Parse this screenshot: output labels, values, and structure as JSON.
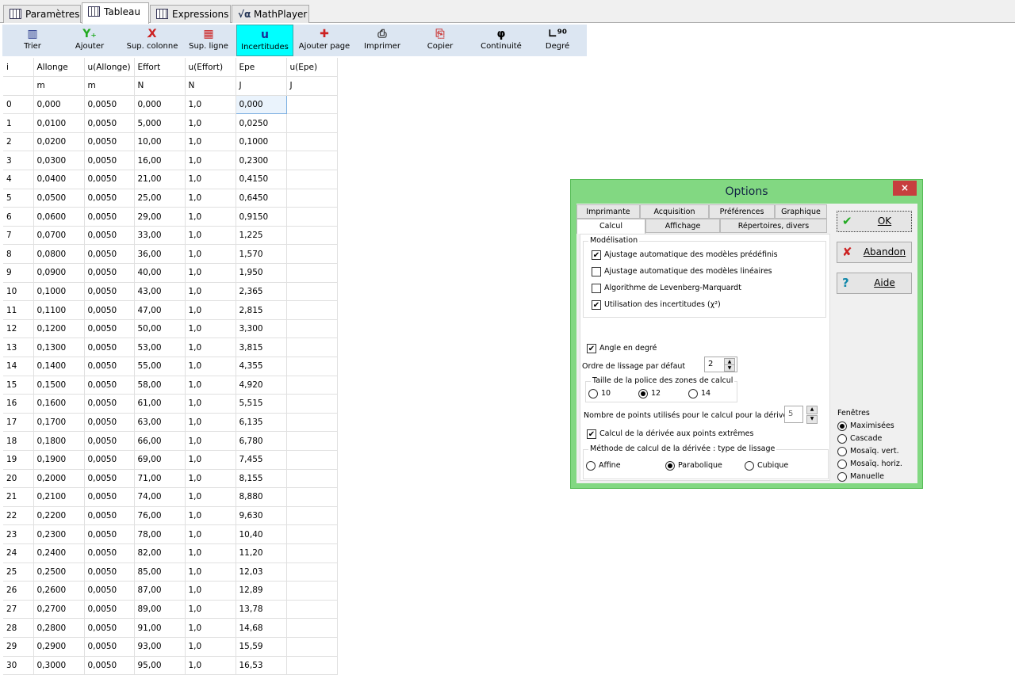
{
  "tabs": [
    {
      "label": "Paramètres",
      "icon": "table-icon"
    },
    {
      "label": "Tableau",
      "icon": "table-icon",
      "active": true
    },
    {
      "label": "Expressions",
      "icon": "expressions-icon"
    },
    {
      "label": "MathPlayer",
      "icon": "sqrt-alpha-icon"
    }
  ],
  "toolbar": [
    {
      "label": "Trier",
      "glyph": "▥",
      "color": "#223388"
    },
    {
      "label": "Ajouter",
      "glyph": "Y₊",
      "color": "#22aa22"
    },
    {
      "label": "Sup. colonne",
      "glyph": "X̸",
      "color": "#cc2222"
    },
    {
      "label": "Sup. ligne",
      "glyph": "▦",
      "color": "#cc2222"
    },
    {
      "label": "Incertitudes",
      "glyph": "u",
      "color": "#1a2a99",
      "active": true
    },
    {
      "label": "Ajouter page",
      "glyph": "✚",
      "color": "#cc2222"
    },
    {
      "label": "Imprimer",
      "glyph": "⎙",
      "color": "#333333"
    },
    {
      "label": "Copier",
      "glyph": "⎘",
      "color": "#cc4444"
    },
    {
      "label": "Continuité",
      "glyph": "φ",
      "color": "#000000"
    },
    {
      "label": "Degré",
      "glyph": "∟⁹⁰",
      "color": "#000000"
    }
  ],
  "table": {
    "headers": [
      "i",
      "Allonge",
      "u(Allonge)",
      "Effort",
      "u(Effort)",
      "Epe",
      "u(Epe)"
    ],
    "units": [
      "",
      "m",
      "m",
      "N",
      "N",
      "J",
      "J"
    ],
    "rows": [
      [
        "0",
        "0,000",
        "0,0050",
        "0,000",
        "1,0",
        "0,000",
        ""
      ],
      [
        "1",
        "0,0100",
        "0,0050",
        "5,000",
        "1,0",
        "0,0250",
        ""
      ],
      [
        "2",
        "0,0200",
        "0,0050",
        "10,00",
        "1,0",
        "0,1000",
        ""
      ],
      [
        "3",
        "0,0300",
        "0,0050",
        "16,00",
        "1,0",
        "0,2300",
        ""
      ],
      [
        "4",
        "0,0400",
        "0,0050",
        "21,00",
        "1,0",
        "0,4150",
        ""
      ],
      [
        "5",
        "0,0500",
        "0,0050",
        "25,00",
        "1,0",
        "0,6450",
        ""
      ],
      [
        "6",
        "0,0600",
        "0,0050",
        "29,00",
        "1,0",
        "0,9150",
        ""
      ],
      [
        "7",
        "0,0700",
        "0,0050",
        "33,00",
        "1,0",
        "1,225",
        ""
      ],
      [
        "8",
        "0,0800",
        "0,0050",
        "36,00",
        "1,0",
        "1,570",
        ""
      ],
      [
        "9",
        "0,0900",
        "0,0050",
        "40,00",
        "1,0",
        "1,950",
        ""
      ],
      [
        "10",
        "0,1000",
        "0,0050",
        "43,00",
        "1,0",
        "2,365",
        ""
      ],
      [
        "11",
        "0,1100",
        "0,0050",
        "47,00",
        "1,0",
        "2,815",
        ""
      ],
      [
        "12",
        "0,1200",
        "0,0050",
        "50,00",
        "1,0",
        "3,300",
        ""
      ],
      [
        "13",
        "0,1300",
        "0,0050",
        "53,00",
        "1,0",
        "3,815",
        ""
      ],
      [
        "14",
        "0,1400",
        "0,0050",
        "55,00",
        "1,0",
        "4,355",
        ""
      ],
      [
        "15",
        "0,1500",
        "0,0050",
        "58,00",
        "1,0",
        "4,920",
        ""
      ],
      [
        "16",
        "0,1600",
        "0,0050",
        "61,00",
        "1,0",
        "5,515",
        ""
      ],
      [
        "17",
        "0,1700",
        "0,0050",
        "63,00",
        "1,0",
        "6,135",
        ""
      ],
      [
        "18",
        "0,1800",
        "0,0050",
        "66,00",
        "1,0",
        "6,780",
        ""
      ],
      [
        "19",
        "0,1900",
        "0,0050",
        "69,00",
        "1,0",
        "7,455",
        ""
      ],
      [
        "20",
        "0,2000",
        "0,0050",
        "71,00",
        "1,0",
        "8,155",
        ""
      ],
      [
        "21",
        "0,2100",
        "0,0050",
        "74,00",
        "1,0",
        "8,880",
        ""
      ],
      [
        "22",
        "0,2200",
        "0,0050",
        "76,00",
        "1,0",
        "9,630",
        ""
      ],
      [
        "23",
        "0,2300",
        "0,0050",
        "78,00",
        "1,0",
        "10,40",
        ""
      ],
      [
        "24",
        "0,2400",
        "0,0050",
        "82,00",
        "1,0",
        "11,20",
        ""
      ],
      [
        "25",
        "0,2500",
        "0,0050",
        "85,00",
        "1,0",
        "12,03",
        ""
      ],
      [
        "26",
        "0,2600",
        "0,0050",
        "87,00",
        "1,0",
        "12,89",
        ""
      ],
      [
        "27",
        "0,2700",
        "0,0050",
        "89,00",
        "1,0",
        "13,78",
        ""
      ],
      [
        "28",
        "0,2800",
        "0,0050",
        "91,00",
        "1,0",
        "14,68",
        ""
      ],
      [
        "29",
        "0,2900",
        "0,0050",
        "93,00",
        "1,0",
        "15,59",
        ""
      ],
      [
        "30",
        "0,3000",
        "0,0050",
        "95,00",
        "1,0",
        "16,53",
        ""
      ]
    ]
  },
  "dialog": {
    "title": "Options",
    "tabs_row1": [
      "Imprimante",
      "Acquisition",
      "Préférences",
      "Graphique"
    ],
    "tabs_row2": [
      "Calcul",
      "Affichage",
      "Répertoires, divers"
    ],
    "modelisation": {
      "label": "Modélisation",
      "options": [
        {
          "label": "Ajustage automatique des modèles prédéfinis",
          "checked": true
        },
        {
          "label": "Ajustage automatique des modèles linéaires",
          "checked": false
        },
        {
          "label": "Algorithme de Levenberg-Marquardt",
          "checked": false
        },
        {
          "label": "Utilisation des incertitudes (χ²)",
          "checked": true
        }
      ]
    },
    "angle": {
      "label": "Angle en degré",
      "checked": true
    },
    "ordre": {
      "label": "Ordre de lissage par défaut",
      "value": "2"
    },
    "police": {
      "label": "Taille de la police des zones de calcul",
      "options": [
        "10",
        "12",
        "14"
      ],
      "selected": "12"
    },
    "points": {
      "label": "Nombre de points utilisés pour le calcul pour la dérivée",
      "value": "5"
    },
    "extremes": {
      "label": "Calcul de la dérivée aux points extrêmes",
      "checked": true
    },
    "methode": {
      "label": "Méthode de calcul de la dérivée : type de lissage",
      "options": [
        "Affine",
        "Parabolique",
        "Cubique"
      ],
      "selected": "Parabolique"
    },
    "fenetres": {
      "label": "Fenêtres",
      "options": [
        "Maximisées",
        "Cascade",
        "Mosaïq. vert.",
        "Mosaïq. horiz.",
        "Manuelle"
      ],
      "selected": "Maximisées"
    },
    "buttons": {
      "ok": "OK",
      "cancel": "Abandon",
      "help": "Aide"
    },
    "close": "×"
  }
}
